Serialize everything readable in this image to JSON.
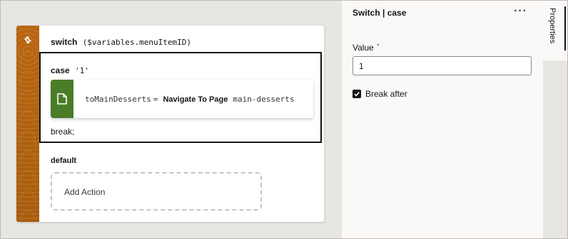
{
  "switch": {
    "keyword": "switch",
    "expression": "($variables.menuItemID)"
  },
  "case": {
    "keyword": "case",
    "value": "'1'",
    "action": {
      "variable": "toMainDesserts",
      "equals": "=",
      "action_name": "Navigate To Page",
      "target": "main-desserts"
    },
    "break_text": "break;"
  },
  "default": {
    "label": "default",
    "add_action_label": "Add Action"
  },
  "properties": {
    "header": "Switch | case",
    "more_label": "···",
    "value_label": "Value",
    "required_mark": "*",
    "value": "1",
    "break_after_label": "Break after",
    "break_after_checked": true
  },
  "tabs": {
    "properties_label": "Properties"
  },
  "colors": {
    "switch_stripe": "#a85c0c",
    "action_icon_bg": "#4b7d29",
    "required": "#3b73d3"
  }
}
